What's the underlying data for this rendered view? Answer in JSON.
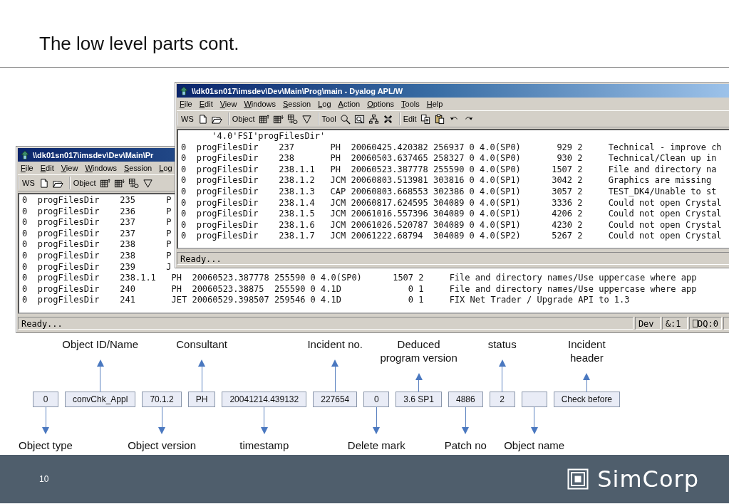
{
  "slide": {
    "title": "The low level parts cont.",
    "page_number": "10",
    "logo_text": "SimCorp"
  },
  "windows": [
    {
      "title": "\\\\dk01sn017\\imsdev\\Dev\\Main\\Prog\\main - Dyalog APL/W",
      "menu": [
        "File",
        "Edit",
        "View",
        "Windows",
        "Session",
        "Log",
        "Action",
        "Options",
        "Tools",
        "Help"
      ],
      "toolbar": [
        {
          "label": "WS"
        },
        {
          "label": "Object"
        },
        {
          "label": "Tool"
        },
        {
          "label": "Edit"
        }
      ],
      "lines": [
        "      '4.0'FSI'progFilesDir'",
        "0  progFilesDir    237       PH  20060425.420382 256937 0 4.0(SP0)       929 2     Technical - improve ch",
        "0  progFilesDir    238       PH  20060503.637465 258327 0 4.0(SP0)       930 2     Technical/Clean up in",
        "0  progFilesDir    238.1.1   PH  20060523.387778 255590 0 4.0(SP0)      1507 2     File and directory na",
        "0  progFilesDir    238.1.2   JCM 20060803.513981 303816 0 4.0(SP1)      3042 2     Graphics are missing",
        "0  progFilesDir    238.1.3   CAP 20060803.668553 302386 0 4.0(SP1)      3057 2     TEST_DK4/Unable to st",
        "0  progFilesDir    238.1.4   JCM 20060817.624595 304089 0 4.0(SP1)      3336 2     Could not open Crystal",
        "0  progFilesDir    238.1.5   JCM 20061016.557396 304089 0 4.0(SP1)      4206 2     Could not open Crystal",
        "0  progFilesDir    238.1.6   JCM 20061026.520787 304089 0 4.0(SP1)      4230 2     Could not open Crystal",
        "0  progFilesDir    238.1.7   JCM 20061222.68794  304089 0 4.0(SP2)      5267 2     Could not open Crystal"
      ],
      "status": {
        "text": "Ready..."
      }
    },
    {
      "title": "\\\\dk01sn017\\imsdev\\Dev\\Main\\Pr",
      "menu": [
        "File",
        "Edit",
        "View",
        "Windows",
        "Session",
        "Log"
      ],
      "toolbar": [
        {
          "label": "WS"
        },
        {
          "label": "Object"
        }
      ],
      "lines": [
        "0  progFilesDir    235      P",
        "0  progFilesDir    236      P",
        "0  progFilesDir    237      P",
        "0  progFilesDir    237      P",
        "0  progFilesDir    238      P",
        "0  progFilesDir    238      P",
        "0  progFilesDir    239      J",
        "0  progFilesDir    238.1.1   PH  20060523.387778 255590 0 4.0(SP0)      1507 2     File and directory names/Use uppercase where app",
        "0  progFilesDir    240       PH  20060523.38875  255590 0 4.1D             0 1     File and directory names/Use uppercase where app",
        "0  progFilesDir    241       JET 20060529.398507 259546 0 4.1D             0 1     FIX Net Trader / Upgrade API to 1.3"
      ],
      "status": {
        "text": "Ready...",
        "panels": [
          "Dev",
          "&:1",
          "⎕DQ:0"
        ]
      }
    }
  ],
  "fields": [
    {
      "value": "0",
      "label": "Object type",
      "kind": "below"
    },
    {
      "value": "convChk_Appl",
      "label": "Object ID/Name",
      "kind": "above"
    },
    {
      "value": "70.1.2",
      "label": "Object version",
      "kind": "below"
    },
    {
      "value": "PH",
      "label": "Consultant",
      "kind": "above"
    },
    {
      "value": "20041214.439132",
      "label": "timestamp",
      "kind": "below"
    },
    {
      "value": "227654",
      "label": "Incident no.",
      "kind": "above"
    },
    {
      "value": "0",
      "label": "Delete mark",
      "kind": "below"
    },
    {
      "value": "3.6 SP1",
      "label": "Deduced\nprogram version",
      "kind": "above"
    },
    {
      "value": "4886",
      "label": "Patch no",
      "kind": "below"
    },
    {
      "value": "2",
      "label": "status",
      "kind": "above"
    },
    {
      "label": "Object name",
      "kind": "below"
    },
    {
      "value": "Check before",
      "label": "Incident\nheader",
      "kind": "above"
    }
  ]
}
